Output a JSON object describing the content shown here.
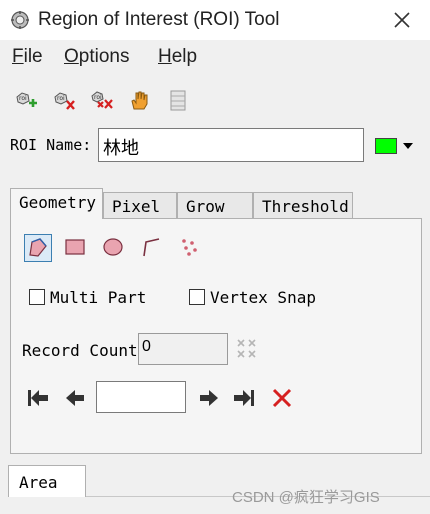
{
  "window": {
    "title": "Region of Interest (ROI) Tool",
    "app_icon": "gear-app-icon",
    "close_icon": "close-icon"
  },
  "menu": [
    {
      "label": "File",
      "mnemonic": "F"
    },
    {
      "label": "Options",
      "mnemonic": "O"
    },
    {
      "label": "Help",
      "mnemonic": "H"
    }
  ],
  "toolbar": [
    {
      "icon": "new-roi-icon",
      "badge": "roi"
    },
    {
      "icon": "delete-roi-icon",
      "badge": "roi"
    },
    {
      "icon": "delete-all-roi-icon",
      "badge": "roi"
    },
    {
      "icon": "hand-icon"
    },
    {
      "icon": "table-icon"
    }
  ],
  "roi": {
    "label": "ROI Name:",
    "value": "林地",
    "color": "#00ff00"
  },
  "tabs": [
    "Geometry",
    "Pixel",
    "Grow",
    "Threshold"
  ],
  "geometry_tools": [
    "polygon-tool-icon",
    "rectangle-tool-icon",
    "ellipse-tool-icon",
    "polyline-tool-icon",
    "point-tool-icon"
  ],
  "options": {
    "multi_part": "Multi Part",
    "vertex_snap": "Vertex Snap"
  },
  "record": {
    "label": "Record Count",
    "value": "0"
  },
  "navigation": {
    "value": "",
    "icons": [
      "first-record-icon",
      "previous-record-icon",
      "next-record-icon",
      "last-record-icon",
      "delete-record-icon"
    ]
  },
  "bottom_tab": "Area",
  "watermark": "CSDN @疯狂学习GIS"
}
